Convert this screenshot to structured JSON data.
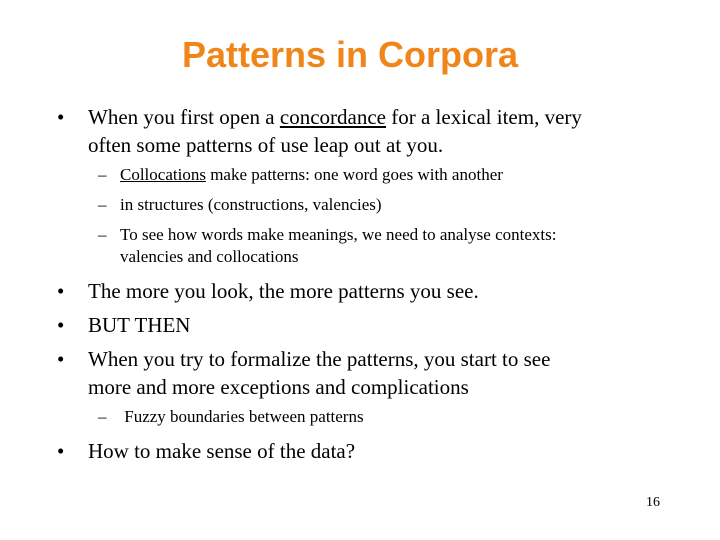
{
  "slide": {
    "title": "Patterns in Corpora",
    "title_color": "#f0861a",
    "bullet_glyph": "•",
    "dash_glyph": "–",
    "bullets": [
      {
        "pre": "When you first open a ",
        "underlined": "concordance",
        "post": " for a lexical item, very",
        "line2": "often some patterns of use leap out at you."
      }
    ],
    "sub1": [
      {
        "underlined": "Collocations",
        "post": " make patterns: one word goes with another"
      },
      {
        "text": "in structures (constructions, valencies)"
      },
      {
        "text": "To see how words make meanings, we need to analyse contexts:",
        "line2": "valencies and collocations"
      }
    ],
    "bullets2": [
      {
        "text": "The more you look, the more patterns you see."
      },
      {
        "text": "BUT  THEN"
      },
      {
        "text": "When you try to formalize the patterns, you start to see",
        "line2": "more and more exceptions and complications"
      }
    ],
    "sub2": [
      {
        "text": " Fuzzy boundaries between patterns"
      }
    ],
    "last_bullet": "How to make sense of the data?",
    "page_number": "16"
  }
}
